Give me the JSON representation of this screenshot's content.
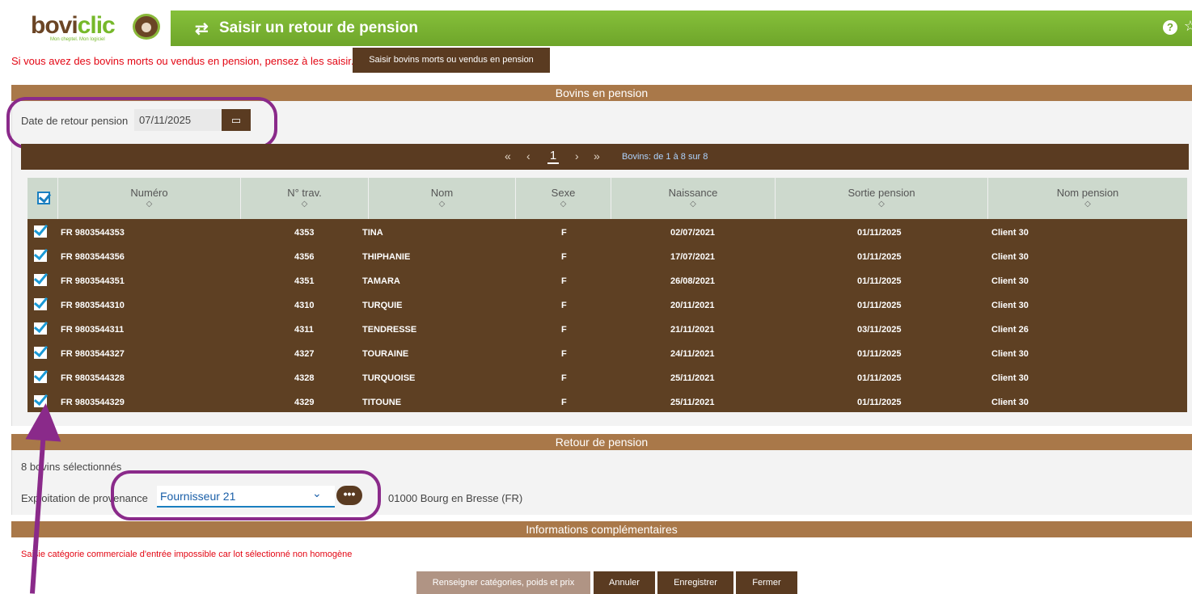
{
  "app": {
    "logo_text_1": "bovi",
    "logo_text_2": "clic",
    "logo_tagline": "Mon cheptel. Mon logiciel",
    "title": "Saisir un retour de pension",
    "title_icon": "swap-arrows-icon",
    "help_icon": "question-circle-icon",
    "star_icon": "star-icon"
  },
  "alert": {
    "message": "Si vous avez des bovins morts ou vendus en pension, pensez à les saisir.",
    "button_label": "Saisir bovins morts ou vendus en pension"
  },
  "bovins_section": {
    "title": "Bovins en pension",
    "date_label": "Date de retour pension",
    "date_value": "07/11/2025",
    "calendar_icon": "calendar-icon"
  },
  "pager": {
    "first": "«",
    "prev": "‹",
    "page": "1",
    "next": "›",
    "last": "»",
    "count_text": "Bovins: de 1 à 8 sur 8"
  },
  "table": {
    "columns": [
      "Numéro",
      "N° trav.",
      "Nom",
      "Sexe",
      "Naissance",
      "Sortie pension",
      "Nom pension"
    ],
    "sort_glyph": "◇",
    "rows": [
      {
        "numero": "FR 9803544353",
        "trav": "4353",
        "nom": "TINA",
        "sexe": "F",
        "naissance": "02/07/2021",
        "sortie": "01/11/2025",
        "pension": "Client 30"
      },
      {
        "numero": "FR 9803544356",
        "trav": "4356",
        "nom": "THIPHANIE",
        "sexe": "F",
        "naissance": "17/07/2021",
        "sortie": "01/11/2025",
        "pension": "Client 30"
      },
      {
        "numero": "FR 9803544351",
        "trav": "4351",
        "nom": "TAMARA",
        "sexe": "F",
        "naissance": "26/08/2021",
        "sortie": "01/11/2025",
        "pension": "Client 30"
      },
      {
        "numero": "FR 9803544310",
        "trav": "4310",
        "nom": "TURQUIE",
        "sexe": "F",
        "naissance": "20/11/2021",
        "sortie": "01/11/2025",
        "pension": "Client 30"
      },
      {
        "numero": "FR 9803544311",
        "trav": "4311",
        "nom": "TENDRESSE",
        "sexe": "F",
        "naissance": "21/11/2021",
        "sortie": "03/11/2025",
        "pension": "Client 26"
      },
      {
        "numero": "FR 9803544327",
        "trav": "4327",
        "nom": "TOURAINE",
        "sexe": "F",
        "naissance": "24/11/2021",
        "sortie": "01/11/2025",
        "pension": "Client 30"
      },
      {
        "numero": "FR 9803544328",
        "trav": "4328",
        "nom": "TURQUOISE",
        "sexe": "F",
        "naissance": "25/11/2021",
        "sortie": "01/11/2025",
        "pension": "Client 30"
      },
      {
        "numero": "FR 9803544329",
        "trav": "4329",
        "nom": "TITOUNE",
        "sexe": "F",
        "naissance": "25/11/2021",
        "sortie": "01/11/2025",
        "pension": "Client 30"
      }
    ]
  },
  "retour_section": {
    "title": "Retour de pension",
    "selected_count": "8 bovins sélectionnés",
    "exploitation_label": "Exploitation de provenance",
    "exploitation_value": "Fournisseur 21",
    "more_label": "•••",
    "address": "01000 Bourg en Bresse (FR)"
  },
  "info_section": {
    "title": "Informations complémentaires",
    "warning": "Saisie catégorie commerciale d'entrée impossible car lot sélectionné non homogène"
  },
  "buttons": {
    "renseigner": "Renseigner catégories, poids et prix",
    "annuler": "Annuler",
    "enregistrer": "Enregistrer",
    "fermer": "Fermer"
  },
  "colors": {
    "brand_green": "#76b82a",
    "brand_brown": "#5a3b21",
    "section_brown": "#a97849",
    "annotation_purple": "#8a2a8a",
    "alert_red": "#e30613"
  }
}
